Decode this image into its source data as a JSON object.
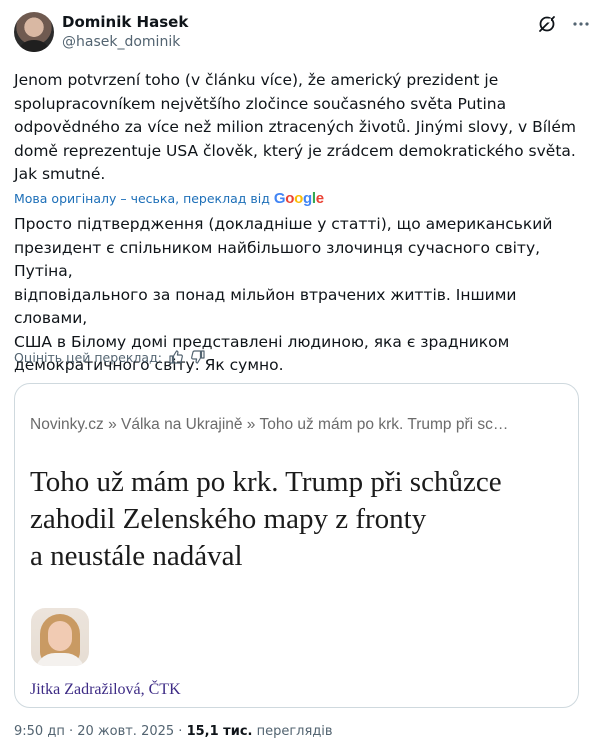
{
  "author": {
    "name": "Dominik Hasek",
    "handle": "@hasek_dominik"
  },
  "tweet": {
    "text": "Jenom potvrzení toho (v článku více), že americký prezident je\nspolupracovníkem největšího zločince současného světa Putina\nodpovědného za více než milion ztracených životů. Jinými slovy, v Bílém\ndomě reprezentuje USA člověk, který je zrádcem demokratického světa.\nJak smutné."
  },
  "translation": {
    "note": "Мова оригіналу – чеська, переклад від",
    "provider": "Google",
    "text": "Просто підтвердження (докладніше у статті), що американський\nпрезидент є спільником найбільшого злочинця сучасного світу, Путіна,\nвідповідального за понад мільйон втрачених життів. Іншими словами,\nСША в Білому домі представлені людиною, яка є зрадником\nдемократичного світу. Як сумно.",
    "rate_label": "Оцініть цей переклад:"
  },
  "card": {
    "breadcrumb": "Novinky.cz » Válka na Ukrajině » Toho už mám po krk. Trump při sc…",
    "headline": "Toho už mám po krk. Trump při schůzce\nzahodil Zelenského mapy z fronty\na neustále nadával",
    "author": "Jitka Zadražilová, ČTK"
  },
  "meta": {
    "time": "9:50 дп",
    "separator": " · ",
    "date": "20 жовт. 2025",
    "views_count": "15,1 тис.",
    "views_label": "переглядів"
  },
  "icons": {
    "grok": "grok-icon",
    "more": "more-icon",
    "thumb_up": "thumb-up-icon",
    "thumb_down": "thumb-down-icon"
  },
  "colors": {
    "text": "#0f1419",
    "secondary": "#536471",
    "link": "#1d6fb8",
    "author_link": "#3d2b85"
  }
}
